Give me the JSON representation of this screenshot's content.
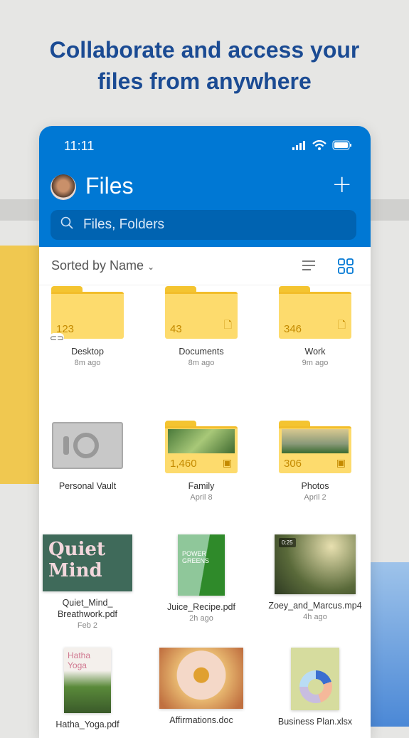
{
  "headline": {
    "line1": "Collaborate and access your",
    "line2": "files from anywhere"
  },
  "status_bar": {
    "time": "11:11",
    "icons": [
      "signal-icon",
      "wifi-icon",
      "battery-icon"
    ]
  },
  "header": {
    "title": "Files",
    "add_icon": "plus-icon",
    "search_placeholder": "Files, Folders"
  },
  "sort": {
    "label": "Sorted by Name",
    "view_modes": [
      "list-view",
      "grid-view"
    ],
    "active_view": "grid-view"
  },
  "colors": {
    "brand": "#0078d4",
    "folder": "#fddb6d",
    "headline": "#1b4b93"
  },
  "items": [
    {
      "name": "Desktop",
      "sub": "8m ago",
      "count": "123",
      "type": "folder",
      "shared": true
    },
    {
      "name": "Documents",
      "sub": "8m ago",
      "count": "43",
      "type": "folder"
    },
    {
      "name": "Work",
      "sub": "9m ago",
      "count": "346",
      "type": "folder"
    },
    {
      "name": "Personal Vault",
      "sub": "",
      "type": "vault"
    },
    {
      "name": "Family",
      "sub": "April 8",
      "count": "1,460",
      "type": "photo-folder"
    },
    {
      "name": "Photos",
      "sub": "April 2",
      "count": "306",
      "type": "photo-folder"
    },
    {
      "name": "Quiet_Mind_ Breathwork.pdf",
      "sub": "Feb 2",
      "thumb_text": "Quiet Mind",
      "type": "pdf"
    },
    {
      "name": "Juice_Recipe.pdf",
      "sub": "2h ago",
      "thumb_text": "POWER GREENS",
      "type": "pdf"
    },
    {
      "name": "Zoey_and_Marcus.mp4",
      "sub": "4h ago",
      "thumb_text": "0:25",
      "type": "video"
    },
    {
      "name": "Hatha_Yoga.pdf",
      "sub": "",
      "thumb_text": "Hatha Yoga",
      "type": "pdf"
    },
    {
      "name": "Affirmations.doc",
      "sub": "",
      "type": "doc"
    },
    {
      "name": "Business Plan.xlsx",
      "sub": "",
      "type": "xlsx"
    }
  ]
}
